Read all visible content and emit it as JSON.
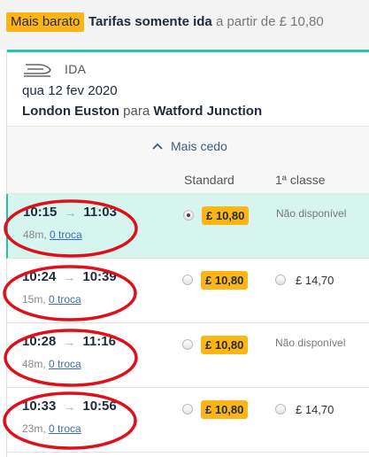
{
  "topbar": {
    "badge": "Mais barato",
    "title": "Tarifas somente ida",
    "subtitle": "a partir de £ 10,80"
  },
  "journey": {
    "direction": "IDA",
    "icon": "train-icon",
    "date": "qua 12 fev 2020",
    "origin": "London Euston",
    "connector": "para",
    "destination": "Watford Junction"
  },
  "earlier": {
    "label": "Mais cedo",
    "icon": "chevron-up-icon"
  },
  "columns": {
    "standard": "Standard",
    "first": "1ª classe"
  },
  "trains": [
    {
      "depart": "10:15",
      "arrive": "11:03",
      "duration": "48m,",
      "changes": "0 troca",
      "standard_price": "£ 10,80",
      "standard_selected": true,
      "first_price": "Não disponível"
    },
    {
      "depart": "10:24",
      "arrive": "10:39",
      "duration": "15m,",
      "changes": "0 troca",
      "standard_price": "£ 10,80",
      "standard_selected": false,
      "first_price": "£ 14,70"
    },
    {
      "depart": "10:28",
      "arrive": "11:16",
      "duration": "48m,",
      "changes": "0 troca",
      "standard_price": "£ 10,80",
      "standard_selected": false,
      "first_price": "Não disponível"
    },
    {
      "depart": "10:33",
      "arrive": "10:56",
      "duration": "23m,",
      "changes": "0 troca",
      "standard_price": "£ 10,80",
      "standard_selected": false,
      "first_price": "£ 14,70"
    }
  ],
  "colors": {
    "accent": "#1fc7a6",
    "price_badge": "#fdb515",
    "selected_row": "#d6f5ee",
    "annotation": "#e0101a"
  }
}
